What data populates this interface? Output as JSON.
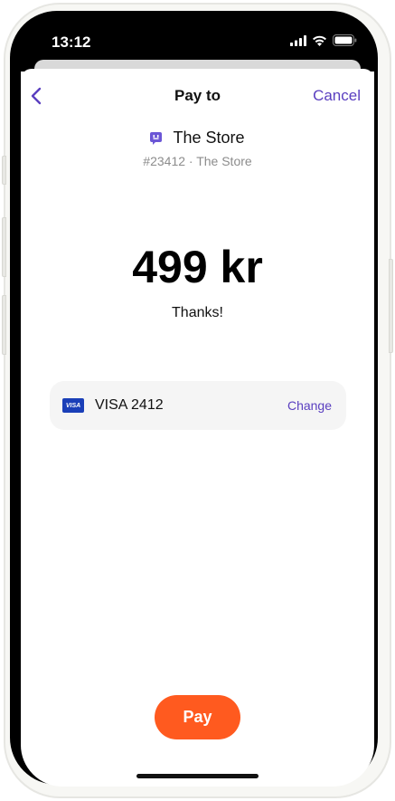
{
  "status_bar": {
    "time": "13:12",
    "icons": [
      "cellular-signal-icon",
      "wifi-icon",
      "battery-icon"
    ]
  },
  "nav": {
    "back_icon": "chevron-left-icon",
    "title": "Pay to",
    "cancel_label": "Cancel"
  },
  "merchant": {
    "icon": "store-icon",
    "name": "The Store",
    "subtitle": "#23412 · The Store"
  },
  "payment": {
    "amount": "499 kr",
    "message": "Thanks!"
  },
  "card": {
    "brand_logo_text": "VISA",
    "label": "VISA 2412",
    "change_label": "Change"
  },
  "actions": {
    "pay_label": "Pay"
  },
  "colors": {
    "accent": "#5a3fc0",
    "pay_button": "#ff5a1f",
    "card_brand": "#1a3fb8"
  }
}
